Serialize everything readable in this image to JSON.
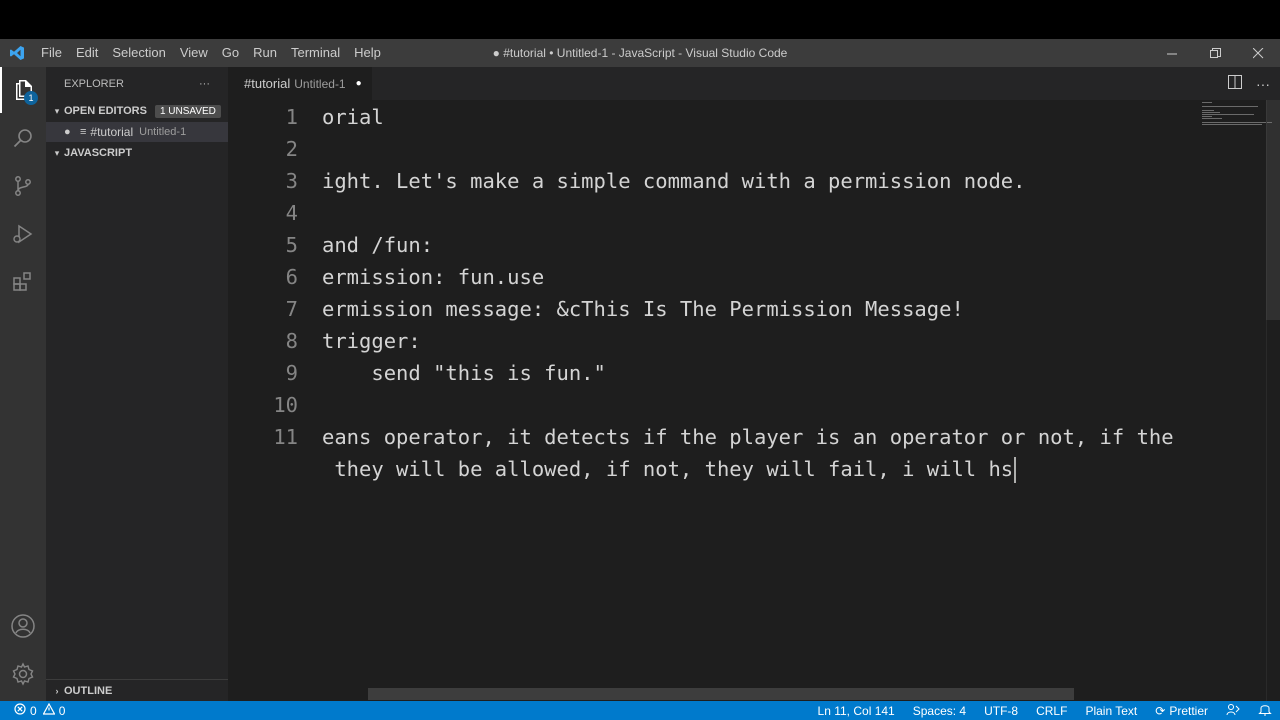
{
  "window": {
    "title": "● #tutorial • Untitled-1 - JavaScript - Visual Studio Code",
    "menu": [
      "File",
      "Edit",
      "Selection",
      "View",
      "Go",
      "Run",
      "Terminal",
      "Help"
    ]
  },
  "activity_bar": {
    "explorer_badge": "1",
    "icons": [
      "files-icon",
      "search-icon",
      "source-control-icon",
      "run-debug-icon",
      "extensions-icon",
      "account-icon",
      "gear-icon"
    ]
  },
  "sidebar": {
    "header": "EXPLORER",
    "more": "···",
    "open_editors": {
      "label": "OPEN EDITORS",
      "badge": "1 UNSAVED"
    },
    "open_file": {
      "name": "#tutorial",
      "desc": "Untitled-1"
    },
    "javascript": "JAVASCRIPT",
    "outline": "OUTLINE"
  },
  "tab": {
    "name": "#tutorial",
    "desc": "Untitled-1"
  },
  "editor": {
    "lines": [
      {
        "n": "1",
        "text": "orial"
      },
      {
        "n": "2",
        "text": ""
      },
      {
        "n": "3",
        "text": "ight. Let's make a simple command with a permission node."
      },
      {
        "n": "4",
        "text": ""
      },
      {
        "n": "5",
        "text": "and /fun:"
      },
      {
        "n": "6",
        "text": "ermission: fun.use"
      },
      {
        "n": "7",
        "text": "ermission message: &cThis Is The Permission Message!"
      },
      {
        "n": "8",
        "text": "trigger:"
      },
      {
        "n": "9",
        "text": "    send \"this is fun.\""
      },
      {
        "n": "10",
        "text": ""
      },
      {
        "n": "11",
        "text": "eans operator, it detects if the player is an operator or not, if the"
      },
      {
        "n": "",
        "text": " they will be allowed, if not, they will fail, i will hs"
      }
    ]
  },
  "status": {
    "errors": "0",
    "warnings": "0",
    "position": "Ln 11, Col 141",
    "spaces": "Spaces: 4",
    "encoding": "UTF-8",
    "eol": "CRLF",
    "language": "Plain Text",
    "formatter": "Prettier"
  },
  "colors": {
    "status_bar": "#007acc",
    "editor_bg": "#1e1e1e",
    "sidebar_bg": "#252526",
    "activity_bg": "#333333",
    "title_bg": "#3c3c3c"
  }
}
